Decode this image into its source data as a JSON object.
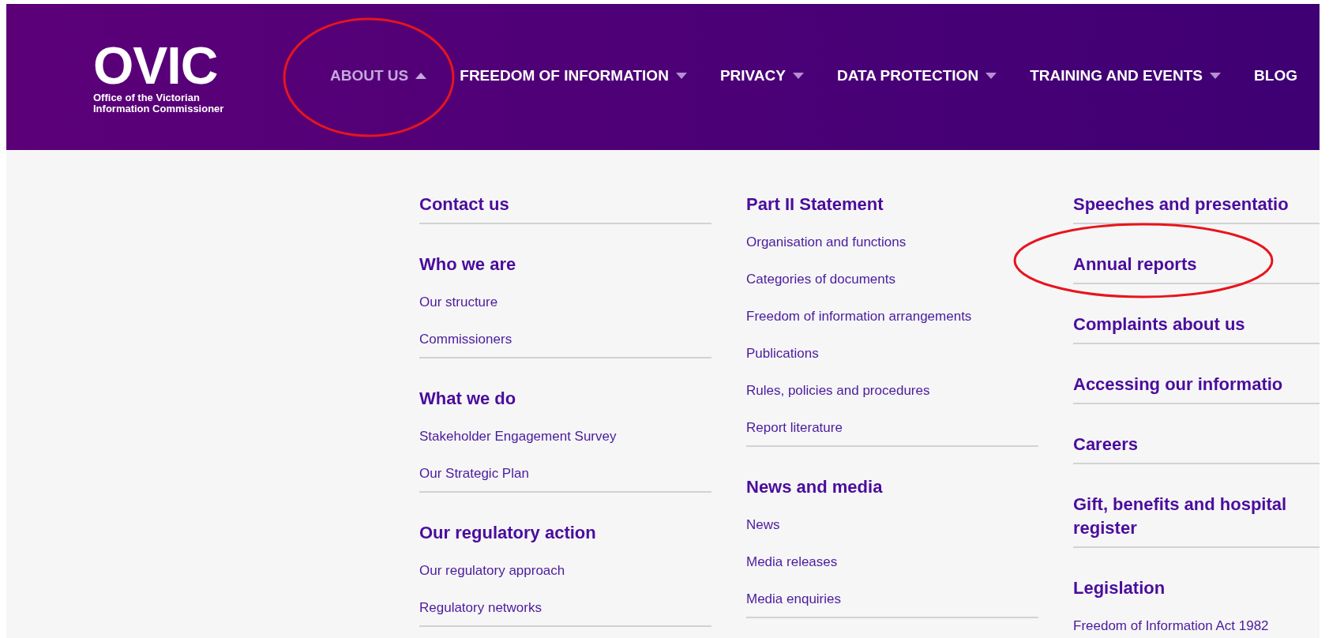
{
  "logo": {
    "wordmark": "OVIC",
    "subtitle": [
      "Office of the Victorian",
      "Information Commissioner"
    ]
  },
  "nav": [
    {
      "label": "ABOUT US",
      "dropdown": true,
      "selected": true
    },
    {
      "label": "FREEDOM OF INFORMATION",
      "dropdown": true,
      "selected": false
    },
    {
      "label": "PRIVACY",
      "dropdown": true,
      "selected": false
    },
    {
      "label": "DATA PROTECTION",
      "dropdown": true,
      "selected": false
    },
    {
      "label": "TRAINING AND EVENTS",
      "dropdown": true,
      "selected": false
    },
    {
      "label": "BLOG",
      "dropdown": false,
      "selected": false
    }
  ],
  "menu_columns": [
    {
      "groups": [
        {
          "heading": [
            "Contact us"
          ]
        },
        {
          "heading": [
            "Who we are"
          ],
          "links": [
            "Our structure",
            "Commissioners"
          ]
        },
        {
          "heading": [
            "What we do"
          ],
          "links": [
            "Stakeholder Engagement Survey",
            "Our Strategic Plan"
          ]
        },
        {
          "heading": [
            "Our regulatory action"
          ],
          "links": [
            "Our regulatory approach",
            "Regulatory networks"
          ]
        }
      ]
    },
    {
      "groups": [
        {
          "heading": [
            "Part II Statement"
          ],
          "links": [
            "Organisation and functions",
            "Categories of documents",
            "Freedom of information arrangements",
            "Publications",
            "Rules, policies and procedures",
            "Report literature"
          ]
        },
        {
          "heading": [
            "News and media"
          ],
          "links": [
            "News",
            "Media releases",
            "Media enquiries"
          ]
        }
      ]
    },
    {
      "groups": [
        {
          "heading": [
            "Speeches and presentatio"
          ]
        },
        {
          "heading": [
            "Annual reports"
          ]
        },
        {
          "heading": [
            "Complaints about us"
          ]
        },
        {
          "heading": [
            "Accessing our informatio"
          ]
        },
        {
          "heading": [
            "Careers"
          ]
        },
        {
          "heading": [
            "Gift, benefits and hospital",
            "register"
          ]
        },
        {
          "heading": [
            "Legislation"
          ],
          "links": [
            "Freedom of Information Act 1982"
          ]
        }
      ]
    }
  ]
}
